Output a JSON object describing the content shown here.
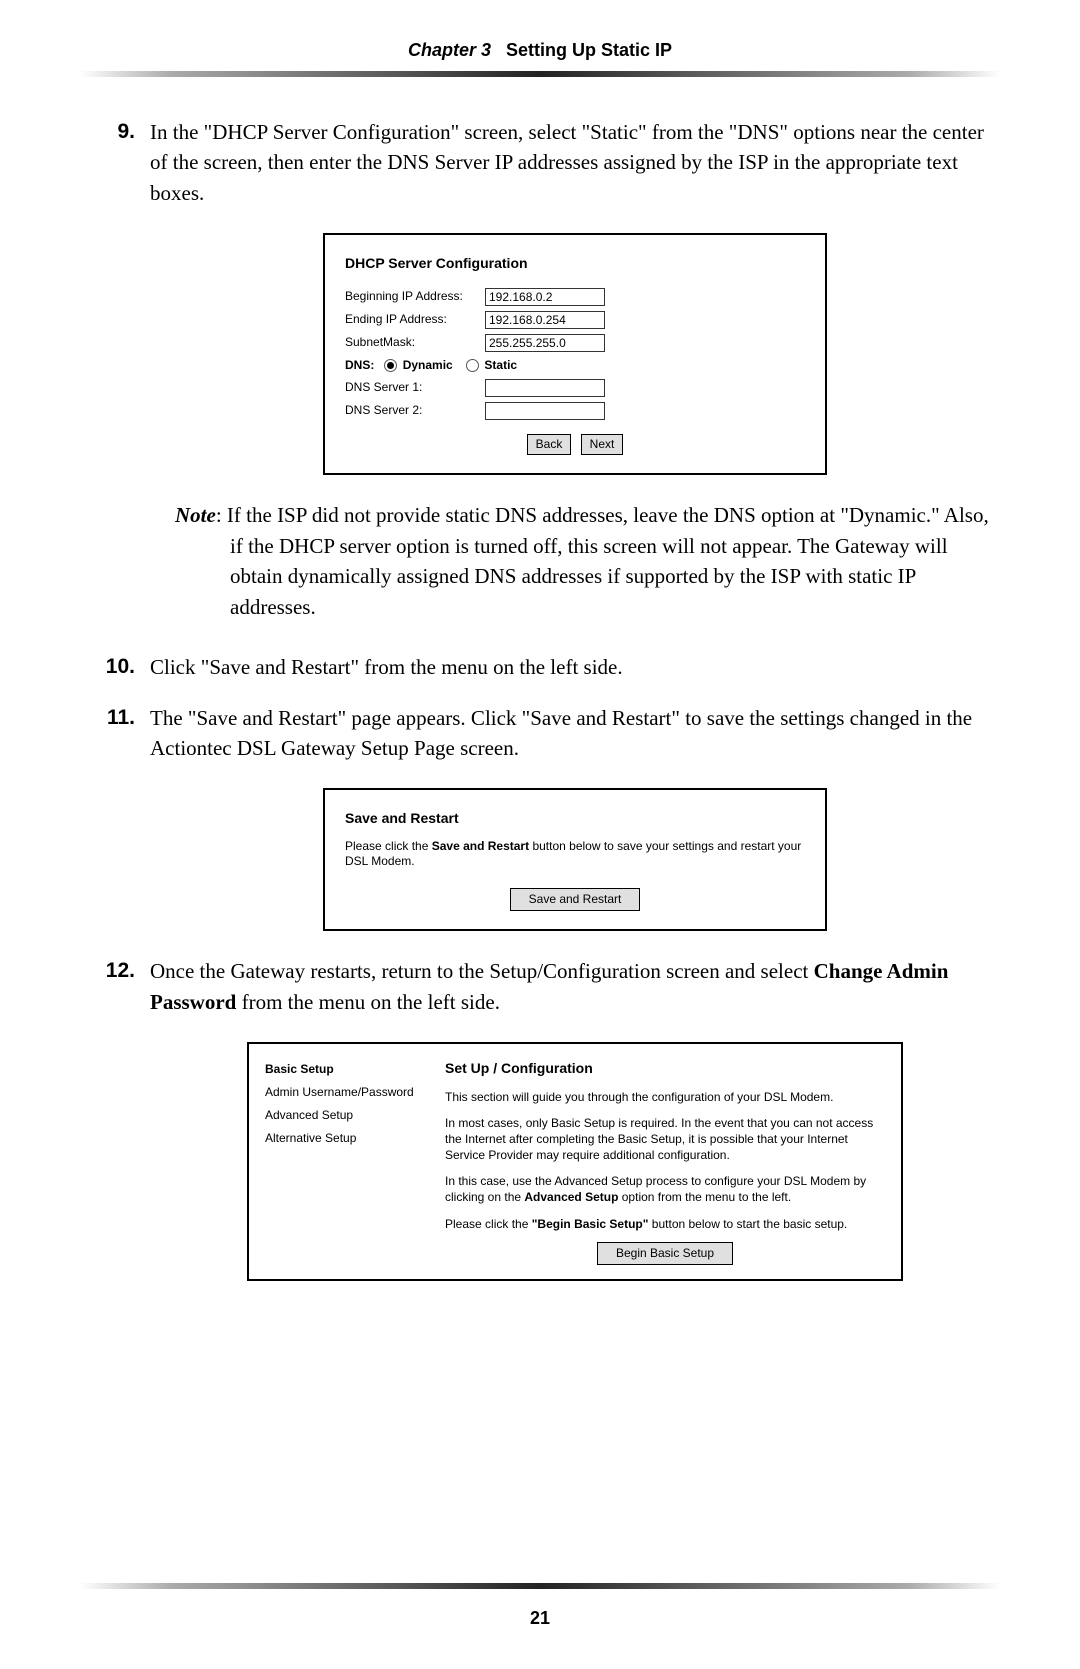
{
  "header": {
    "chapter": "Chapter 3",
    "title": "Setting Up Static IP"
  },
  "steps": {
    "n9": {
      "num": "9.",
      "text_pre": "In the \"",
      "dhcp_sc": "DHCP",
      "text_mid1": " Server Configuration\" screen, select \"Static\" from the \"",
      "dns_sc": "DNS",
      "text_mid2": "\" options near the center of the screen, then enter the ",
      "dns_sc2": "DNS",
      "text_mid3": " Server ",
      "ip_sc": "IP",
      "text_mid4": " addresses assigned by the ",
      "isp_sc": "ISP",
      "text_end": " in the appropriate text boxes."
    },
    "note": {
      "label": "Note",
      "p1a": ": If the ",
      "isp": "ISP",
      "p1b": " did not provide static ",
      "dns": "DNS",
      "p1c": " addresses, leave the ",
      "dns2": "DNS",
      "p2": " option at \"Dynamic.\" Also, if the ",
      "dhcp": "DHCP",
      "p3": " server option is turned off, this screen will not appear. The Gateway will obtain dynamically assigned ",
      "dns3": "DNS",
      "p4": " addresses if supported by the ",
      "isp2": "ISP",
      "p5": " with static ",
      "ip": "IP",
      "p6": " addresses."
    },
    "n10": {
      "num": "10.",
      "text": "Click \"Save and Restart\" from the menu on the left side."
    },
    "n11": {
      "num": "11.",
      "text1": "The \"Save and Restart\" page appears. Click \"Save and Restart\" to save the settings changed in the Actiontec ",
      "dsl": "DSL",
      "text2": " Gateway Setup Page screen."
    },
    "n12": {
      "num": "12.",
      "text1": "Once the Gateway restarts, return to the Setup/Configuration screen and select ",
      "bold": "Change Admin Password",
      "text2": " from the menu on the left side."
    }
  },
  "dhcp_screenshot": {
    "title": "DHCP Server Configuration",
    "rows": {
      "begin": {
        "label": "Beginning IP Address:",
        "value": "192.168.0.2"
      },
      "end": {
        "label": "Ending IP Address:",
        "value": "192.168.0.254"
      },
      "mask": {
        "label": "SubnetMask:",
        "value": "255.255.255.0"
      }
    },
    "dns_label": "DNS:",
    "dynamic_label": "Dynamic",
    "static_label": "Static",
    "server1_label": "DNS Server 1:",
    "server2_label": "DNS Server 2:",
    "back_btn": "Back",
    "next_btn": "Next"
  },
  "sr_screenshot": {
    "title": "Save and Restart",
    "text_pre": "Please click the ",
    "text_bold": "Save and Restart",
    "text_post": " button below to save your settings and restart your DSL Modem.",
    "btn": "Save and Restart"
  },
  "cfg_screenshot": {
    "menu": {
      "basic": "Basic Setup",
      "admin": "Admin Username/Password",
      "advanced": "Advanced Setup",
      "alternative": "Alternative Setup"
    },
    "title": "Set Up / Configuration",
    "p1": "This section will guide you through the configuration of your DSL Modem.",
    "p2": "In most cases, only Basic Setup is required. In the event that you can not access the Internet after completing the Basic Setup, it is possible that your Internet Service Provider may require additional configuration.",
    "p3a": "In this case, use the Advanced Setup process to configure your DSL Modem by clicking on the ",
    "p3bold": "Advanced Setup",
    "p3b": " option from the menu to the left.",
    "p4a": "Please click the ",
    "p4bold": "\"Begin Basic Setup\"",
    "p4b": " button below to start the basic setup.",
    "btn": "Begin Basic Setup"
  },
  "page_number": "21"
}
